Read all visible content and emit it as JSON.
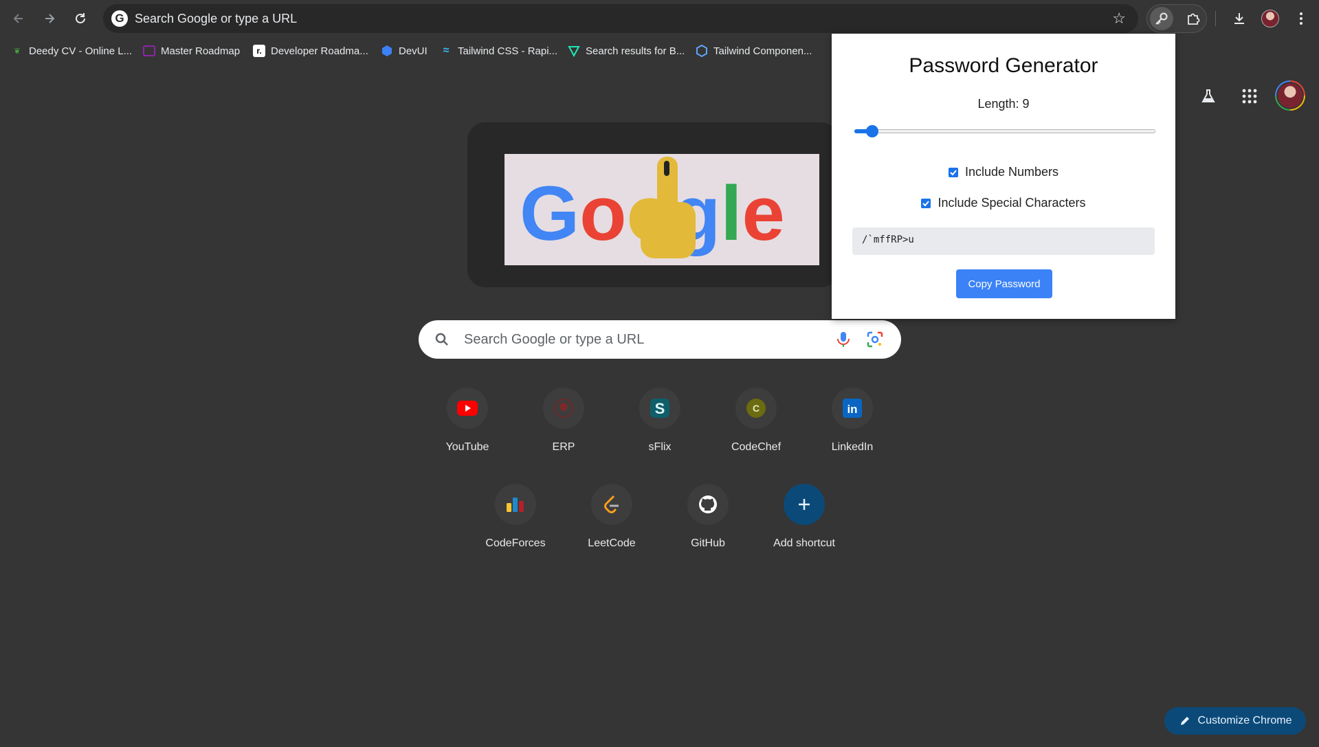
{
  "browser": {
    "omnibox_text": "Search Google or type a URL",
    "bookmarks": [
      {
        "label": "Deedy CV - Online L...",
        "icon": "overleaf-icon"
      },
      {
        "label": "Master Roadmap",
        "icon": "roadmap-icon"
      },
      {
        "label": "Developer Roadma...",
        "icon": "roadmap-sh-icon"
      },
      {
        "label": "DevUI",
        "icon": "devui-icon"
      },
      {
        "label": "Tailwind CSS - Rapi...",
        "icon": "tailwind-icon"
      },
      {
        "label": "Search results for B...",
        "icon": "vuetify-icon"
      },
      {
        "label": "Tailwind Componen...",
        "icon": "component-icon"
      }
    ]
  },
  "ntp": {
    "search_placeholder": "Search Google or type a URL",
    "doodle_text": "Google",
    "shortcuts_row1": [
      {
        "label": "YouTube"
      },
      {
        "label": "ERP"
      },
      {
        "label": "sFlix"
      },
      {
        "label": "CodeChef"
      },
      {
        "label": "LinkedIn"
      }
    ],
    "shortcuts_row2": [
      {
        "label": "CodeForces"
      },
      {
        "label": "LeetCode"
      },
      {
        "label": "GitHub"
      },
      {
        "label": "Add shortcut"
      }
    ],
    "customize_label": "Customize Chrome"
  },
  "popup": {
    "title": "Password Generator",
    "length_label": "Length: 9",
    "length_value": 9,
    "length_fraction": 0.06,
    "include_numbers_label": "Include Numbers",
    "include_numbers_checked": true,
    "include_special_label": "Include Special Characters",
    "include_special_checked": true,
    "password": "/`mffRP>u",
    "copy_label": "Copy Password"
  },
  "colors": {
    "page_bg": "#353535",
    "accent_blue": "#1a73e8",
    "copy_button": "#3b82f6",
    "customize_bg": "#0b4a78"
  }
}
